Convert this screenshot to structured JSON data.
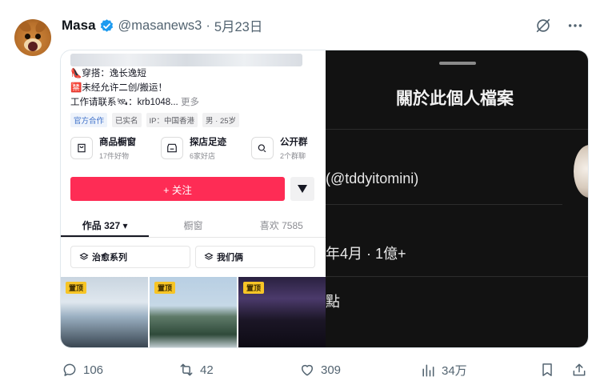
{
  "author": {
    "name": "Masa",
    "handle": "@masanews3",
    "separator": "·",
    "date": "5月23日"
  },
  "left_screenshot": {
    "bio_line1": "👠穿搭：逸长逸短",
    "bio_line2": "🈲未经允许二创/搬运！",
    "bio_line3": "工作请联系🛰：krb1048...",
    "more": "更多",
    "tags": [
      "官方合作",
      "已实名",
      "IP：中国香港",
      "男 · 25岁"
    ],
    "features": [
      {
        "title": "商品橱窗",
        "sub": "17件好物"
      },
      {
        "title": "探店足迹",
        "sub": "6家好店"
      },
      {
        "title": "公开群",
        "sub": "2个群聊"
      }
    ],
    "follow_label": "+ 关注",
    "tabs": [
      "作品 327 ▾",
      "橱窗",
      "喜欢 7585"
    ],
    "chips": [
      "治愈系列",
      "我们俩"
    ],
    "pin_label": "置顶"
  },
  "right_screenshot": {
    "title": "關於此個人檔案",
    "row1": "(@tddyitomini)",
    "row2": "年4月 · 1億+",
    "row3": "點"
  },
  "actions": {
    "replies": "106",
    "reposts": "42",
    "likes": "309",
    "views": "34万"
  }
}
